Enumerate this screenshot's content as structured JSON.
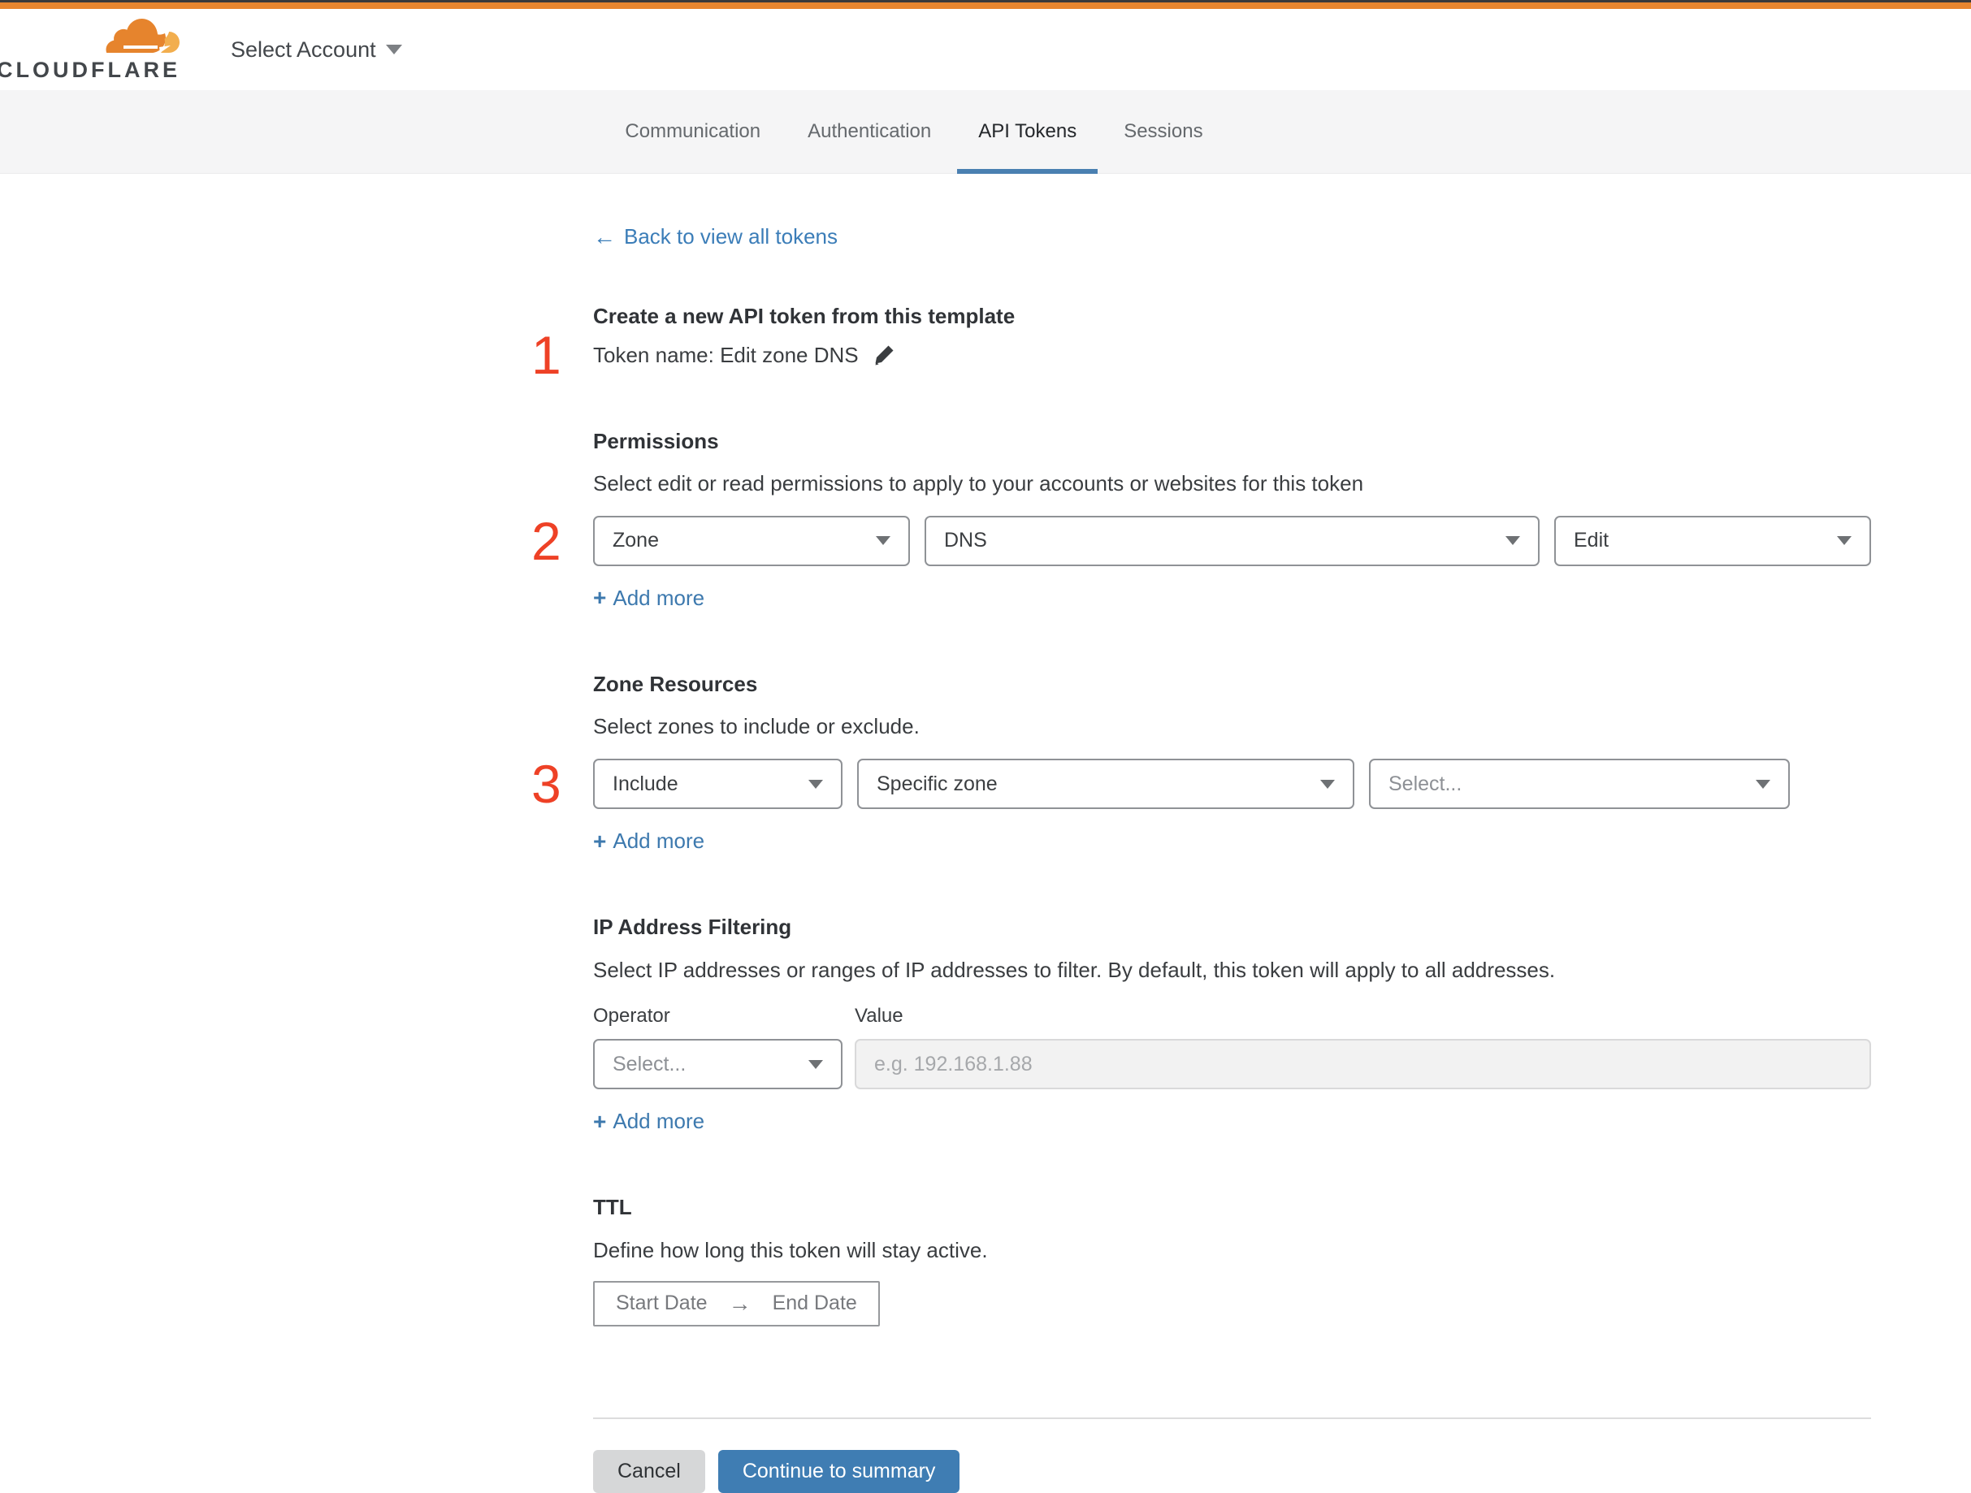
{
  "chrome": {
    "brand_orange": "#e8862f",
    "top_dark": "#3a3a3a"
  },
  "header": {
    "logo_text": "CLOUDFLARE",
    "account_selector_label": "Select Account"
  },
  "tabs": [
    {
      "label": "Communication",
      "active": false
    },
    {
      "label": "Authentication",
      "active": false
    },
    {
      "label": "API Tokens",
      "active": true
    },
    {
      "label": "Sessions",
      "active": false
    }
  ],
  "back_link": {
    "arrow": "←",
    "label": "Back to view all tokens"
  },
  "steps": {
    "one": "1",
    "two": "2",
    "three": "3"
  },
  "token_section": {
    "heading": "Create a new API token from this template",
    "token_name_line": "Token name: Edit zone DNS"
  },
  "add_more": {
    "plus": "+",
    "label": "Add more"
  },
  "permissions": {
    "heading": "Permissions",
    "description": "Select edit or read permissions to apply to your accounts or websites for this token",
    "dropdowns": [
      {
        "value": "Zone"
      },
      {
        "value": "DNS"
      },
      {
        "value": "Edit"
      }
    ]
  },
  "zone_resources": {
    "heading": "Zone Resources",
    "description": "Select zones to include or exclude.",
    "dropdowns": [
      {
        "value": "Include"
      },
      {
        "value": "Specific zone"
      },
      {
        "value": "Select...",
        "placeholder": true
      }
    ]
  },
  "ip_filtering": {
    "heading": "IP Address Filtering",
    "description": "Select IP addresses or ranges of IP addresses to filter. By default, this token will apply to all addresses.",
    "operator_label": "Operator",
    "value_label": "Value",
    "operator_dropdown_value": "Select...",
    "value_placeholder": "e.g. 192.168.1.88"
  },
  "ttl": {
    "heading": "TTL",
    "description": "Define how long this token will stay active.",
    "start_date_label": "Start Date",
    "arrow": "→",
    "end_date_label": "End Date"
  },
  "footer": {
    "cancel_label": "Cancel",
    "continue_label": "Continue to summary"
  },
  "colors": {
    "link_blue": "#3b7db8",
    "accent_blue": "#3f7db3",
    "tab_underline_blue": "#4a80b1",
    "step_red": "#ee4126"
  }
}
